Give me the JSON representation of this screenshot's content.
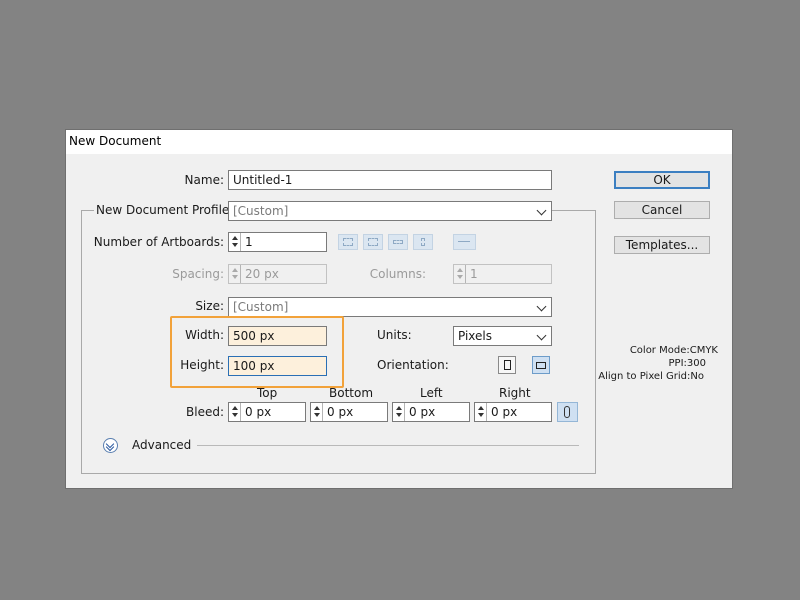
{
  "dialog": {
    "title": "New Document"
  },
  "form": {
    "name_label": "Name:",
    "name_value": "Untitled-1",
    "profile_label": "New Document Profile:",
    "profile_value": "[Custom]",
    "artboards_label": "Number of Artboards:",
    "artboards_value": "1",
    "spacing_label": "Spacing:",
    "spacing_value": "20 px",
    "columns_label": "Columns:",
    "columns_value": "1",
    "size_label": "Size:",
    "size_value": "[Custom]",
    "width_label": "Width:",
    "width_value": "500 px",
    "height_label": "Height:",
    "height_value": "100 px",
    "units_label": "Units:",
    "units_value": "Pixels",
    "orientation_label": "Orientation:",
    "bleed_label": "Bleed:",
    "bleed_headers": {
      "top": "Top",
      "bottom": "Bottom",
      "left": "Left",
      "right": "Right"
    },
    "bleed_values": {
      "top": "0 px",
      "bottom": "0 px",
      "left": "0 px",
      "right": "0 px"
    },
    "advanced_label": "Advanced"
  },
  "buttons": {
    "ok": "OK",
    "cancel": "Cancel",
    "templates": "Templates..."
  },
  "info": {
    "color_mode": "Color Mode:CMYK",
    "ppi": "PPI:300",
    "pixel_grid": "Align to Pixel Grid:No"
  },
  "icons": {
    "artboard_layouts": [
      "grid-by-row-icon",
      "grid-by-column-icon",
      "arrange-by-row-icon",
      "arrange-by-column-icon",
      "right-to-left-icon"
    ],
    "orientation": [
      "portrait-icon",
      "landscape-icon"
    ],
    "bleed_link": "chain-link-icon",
    "advanced": "expand-chevrons-icon"
  },
  "colors": {
    "highlight": "#f2a23a",
    "field_highlight": "#fdf0dc",
    "default_button_border": "#3c7fc1"
  }
}
